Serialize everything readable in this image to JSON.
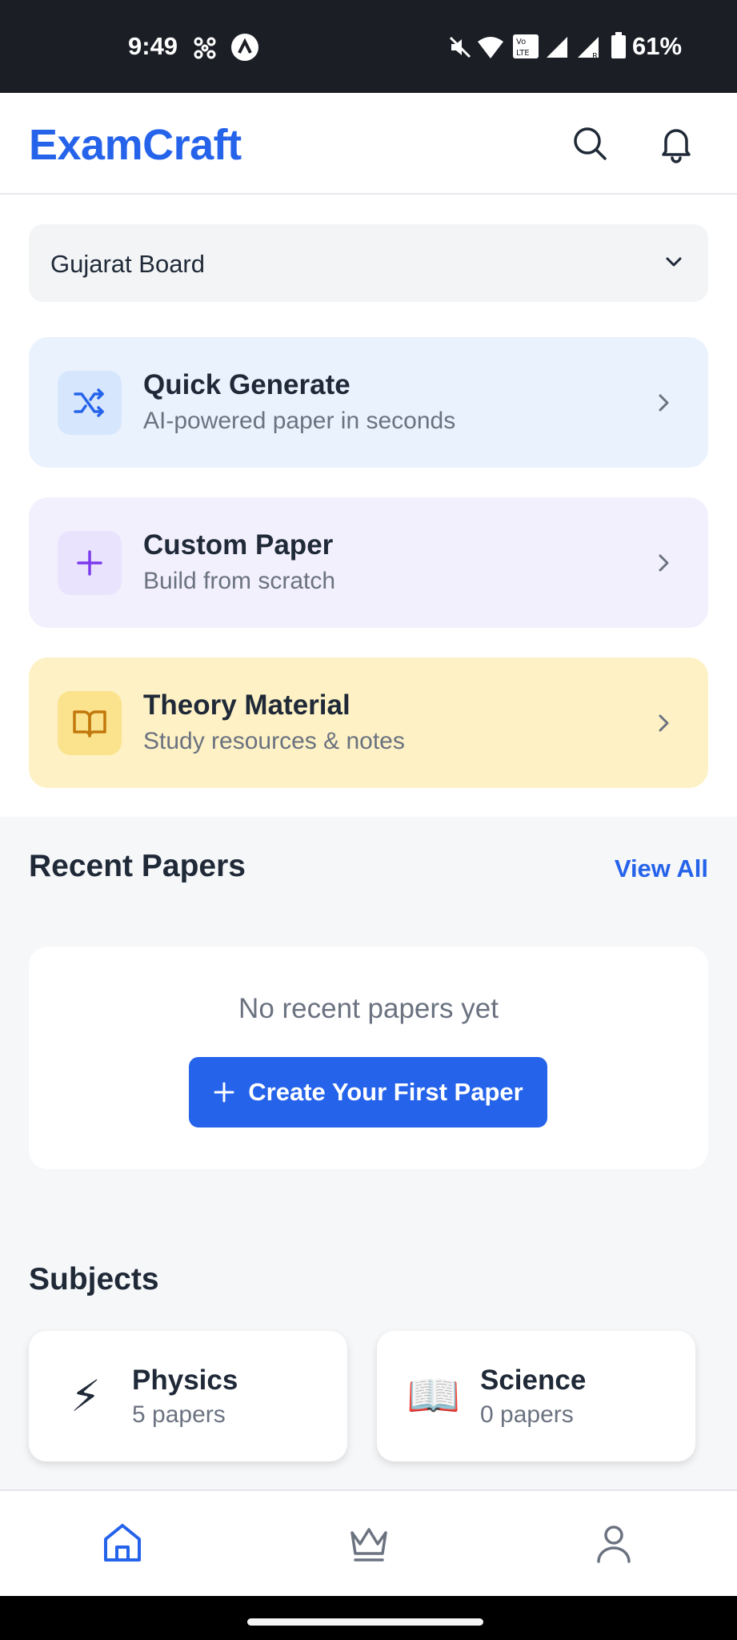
{
  "status_bar": {
    "time": "9:49",
    "battery": "61%",
    "icons": [
      "pinwheel-icon",
      "app-a-icon",
      "mute-icon",
      "wifi-icon",
      "volte-icon",
      "signal-icon",
      "signal-roaming-icon",
      "battery-icon"
    ]
  },
  "header": {
    "logo": "ExamCraft",
    "actions": [
      "search-icon",
      "bell-icon"
    ]
  },
  "board": {
    "selected": "Gujarat Board"
  },
  "actions": [
    {
      "title": "Quick Generate",
      "subtitle": "AI-powered paper in seconds",
      "icon": "shuffle-icon",
      "bg": "#eaf2fe",
      "icon_bg": "#d6e6fc",
      "icon_color": "#2563eb"
    },
    {
      "title": "Custom Paper",
      "subtitle": "Build from scratch",
      "icon": "plus-icon",
      "bg": "#f3f0fe",
      "icon_bg": "#e9e3fd",
      "icon_color": "#7c3aed"
    },
    {
      "title": "Theory Material",
      "subtitle": "Study resources & notes",
      "icon": "book-open-icon",
      "bg": "#fdf1c5",
      "icon_bg": "#fbe38e",
      "icon_color": "#c2780b"
    }
  ],
  "recent": {
    "title": "Recent Papers",
    "view_all": "View All",
    "empty_text": "No recent papers yet",
    "create_label": "Create Your First Paper"
  },
  "subjects": {
    "title": "Subjects",
    "items": [
      {
        "name": "Physics",
        "count": "5 papers",
        "emoji": "⚡"
      },
      {
        "name": "Science",
        "count": "0 papers",
        "emoji": "📖"
      }
    ]
  },
  "nav": {
    "items": [
      "home-icon",
      "crown-icon",
      "profile-icon"
    ],
    "active": "home-icon"
  },
  "colors": {
    "accent": "#2563eb",
    "text": "#1f2937",
    "muted": "#6b7280"
  }
}
